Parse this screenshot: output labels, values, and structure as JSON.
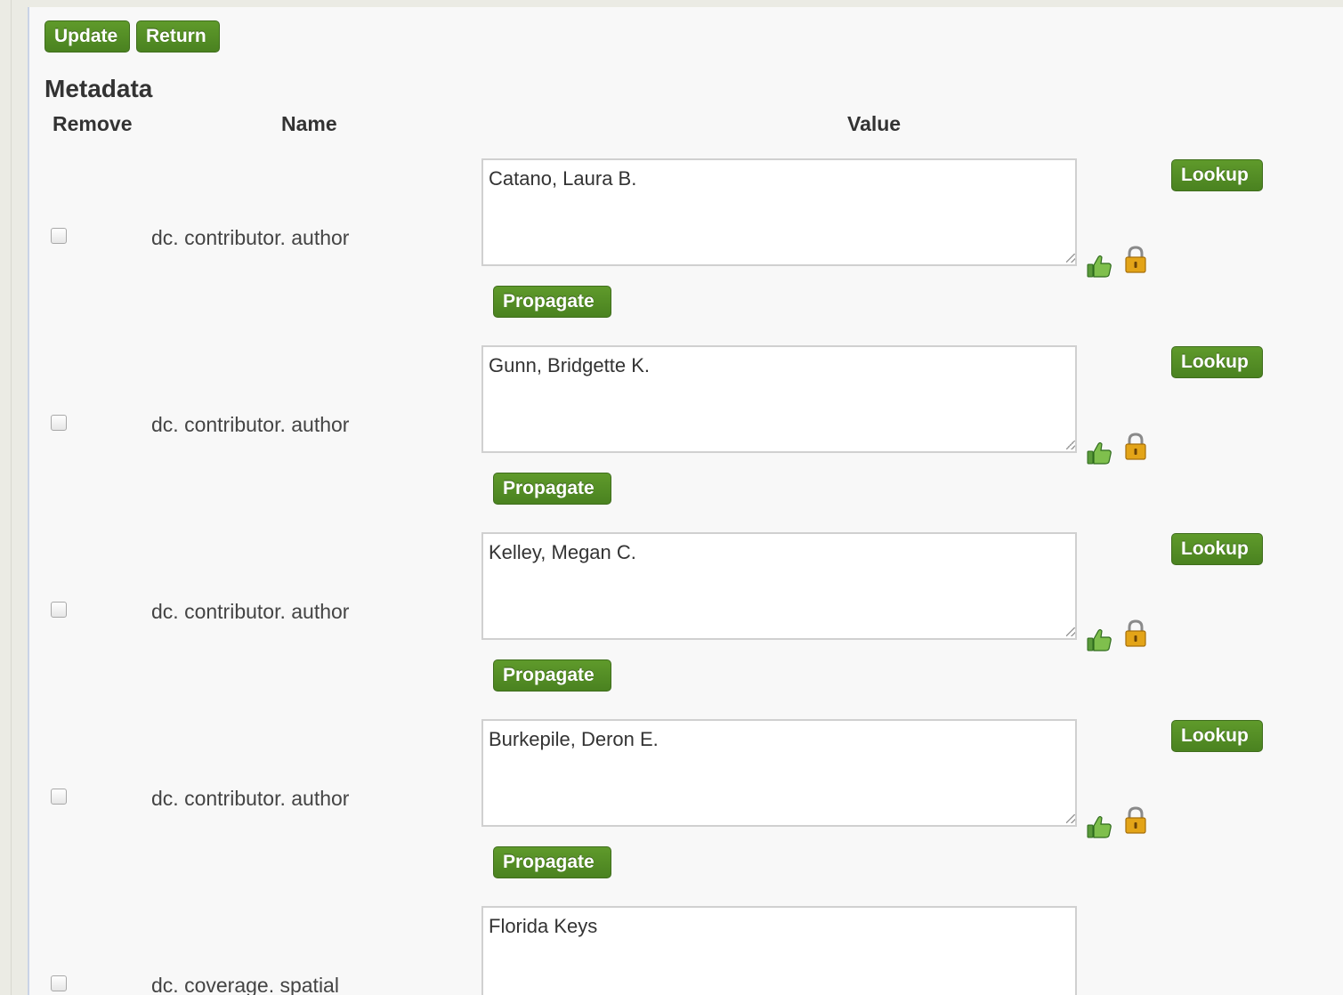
{
  "toolbar": {
    "update_label": "Update",
    "return_label": "Return"
  },
  "section": {
    "title": "Metadata"
  },
  "columns": {
    "remove": "Remove",
    "name": "Name",
    "value": "Value"
  },
  "rows": [
    {
      "name": "dc. contributor. author",
      "value": "Catano, Laura B.",
      "has_actions": true
    },
    {
      "name": "dc. contributor. author",
      "value": "Gunn, Bridgette K.",
      "has_actions": true
    },
    {
      "name": "dc. contributor. author",
      "value": "Kelley, Megan C.",
      "has_actions": true
    },
    {
      "name": "dc. contributor. author",
      "value": "Burkepile, Deron E.",
      "has_actions": true
    },
    {
      "name": "dc. coverage. spatial",
      "value": "Florida Keys",
      "has_actions": false
    }
  ],
  "actions": {
    "lookup_label": "Lookup",
    "propagate_label": "Propagate"
  },
  "icons": {
    "approve": "thumbs-up-icon",
    "lock": "lock-icon"
  },
  "colors": {
    "button_green": "#4a8220",
    "button_border": "#3f6d1c",
    "panel_background": "#f8f8f8",
    "page_background": "#ebebe4",
    "lock_gold": "#e3a418"
  }
}
